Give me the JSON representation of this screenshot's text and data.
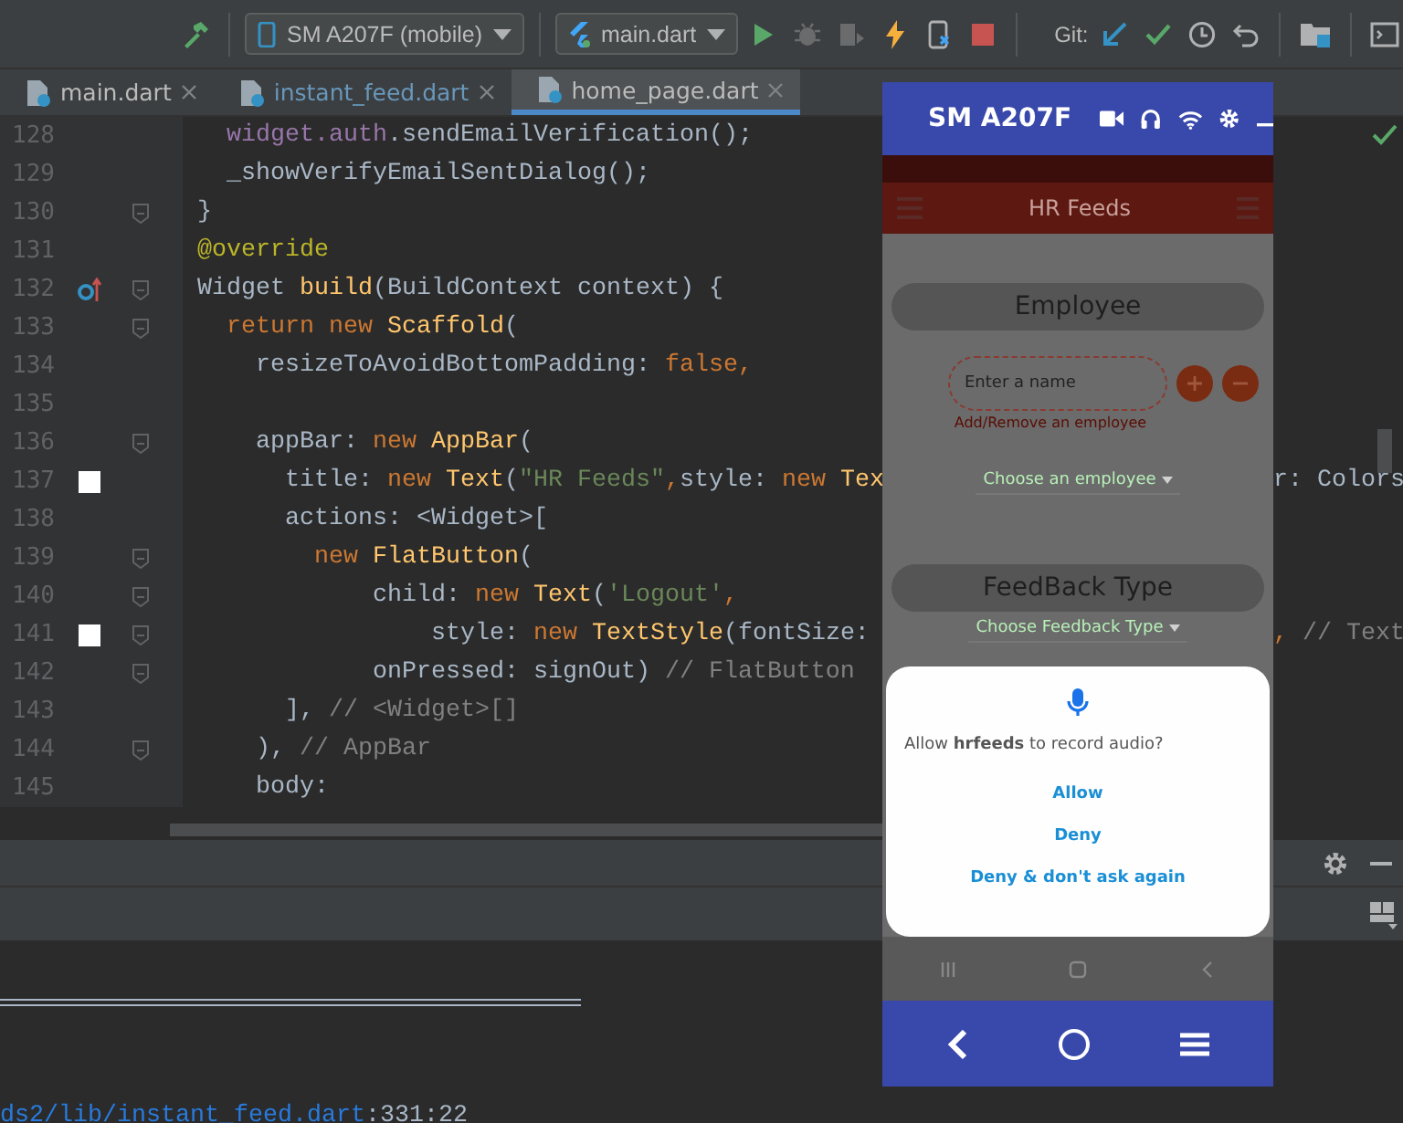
{
  "toolbar": {
    "device": "SM A207F (mobile)",
    "config": "main.dart",
    "git_label": "Git:",
    "actions": [
      {
        "kind": "run",
        "disabled": false
      },
      {
        "kind": "debug",
        "disabled": true
      },
      {
        "kind": "profile",
        "disabled": true
      },
      {
        "kind": "reload",
        "disabled": false
      },
      {
        "kind": "devtools",
        "disabled": false
      },
      {
        "kind": "stop",
        "disabled": false
      }
    ]
  },
  "tabs": [
    {
      "label": "main.dart",
      "selected": false,
      "modified": false
    },
    {
      "label": "instant_feed.dart",
      "selected": false,
      "modified": true
    },
    {
      "label": "home_page.dart",
      "selected": true,
      "modified": false
    }
  ],
  "editor": {
    "lines": [
      {
        "number": "128",
        "tokens": [
          {
            "t": "  widget.auth",
            "kind": "field"
          },
          {
            "t": ".sendEmailVerification();",
            "kind": "plain"
          }
        ]
      },
      {
        "number": "129",
        "tokens": [
          {
            "t": "  _showVerifyEmailSentDialog();",
            "kind": "plain"
          }
        ]
      },
      {
        "number": "130",
        "fold": true,
        "tokens": [
          {
            "t": "}",
            "kind": "plain"
          }
        ]
      },
      {
        "number": "131",
        "tokens": [
          {
            "t": "@override",
            "kind": "annotation"
          }
        ]
      },
      {
        "number": "132",
        "overridden": true,
        "fold": true,
        "tokens": [
          {
            "t": "Widget ",
            "kind": "plain"
          },
          {
            "t": "build",
            "kind": "class"
          },
          {
            "t": "(BuildContext context) {",
            "kind": "plain"
          }
        ]
      },
      {
        "number": "133",
        "fold": true,
        "tokens": [
          {
            "t": "  return new ",
            "kind": "keyword"
          },
          {
            "t": "Scaffold",
            "kind": "class"
          },
          {
            "t": "(",
            "kind": "plain"
          }
        ]
      },
      {
        "number": "134",
        "tokens": [
          {
            "t": "    resizeToAvoidBottomPadding: ",
            "kind": "plain"
          },
          {
            "t": "false,",
            "kind": "keyword"
          }
        ]
      },
      {
        "number": "135"
      },
      {
        "number": "136",
        "fold": true,
        "tokens": [
          {
            "t": "    appBar: ",
            "kind": "plain"
          },
          {
            "t": "new ",
            "kind": "keyword"
          },
          {
            "t": "AppBar",
            "kind": "class"
          },
          {
            "t": "(",
            "kind": "plain"
          }
        ]
      },
      {
        "number": "137",
        "swatch": true,
        "tokens": [
          {
            "t": "      title: ",
            "kind": "plain"
          },
          {
            "t": "new ",
            "kind": "keyword"
          },
          {
            "t": "Text",
            "kind": "class"
          },
          {
            "t": "(",
            "kind": "plain"
          },
          {
            "t": "\"HR Feeds\"",
            "kind": "string"
          },
          {
            "t": ",",
            "kind": "keyword"
          },
          {
            "t": "style: ",
            "kind": "plain"
          },
          {
            "t": "new ",
            "kind": "keyword"
          },
          {
            "t": "Tex",
            "kind": "class"
          }
        ],
        "tail": [
          {
            "t": "r: Colors",
            "kind": "plain"
          }
        ]
      },
      {
        "number": "138",
        "tokens": [
          {
            "t": "      actions: <Widget>[",
            "kind": "plain"
          }
        ]
      },
      {
        "number": "139",
        "fold": true,
        "tokens": [
          {
            "t": "        new ",
            "kind": "keyword"
          },
          {
            "t": "FlatButton",
            "kind": "class"
          },
          {
            "t": "(",
            "kind": "plain"
          }
        ]
      },
      {
        "number": "140",
        "fold": true,
        "tokens": [
          {
            "t": "            child: ",
            "kind": "plain"
          },
          {
            "t": "new ",
            "kind": "keyword"
          },
          {
            "t": "Text",
            "kind": "class"
          },
          {
            "t": "(",
            "kind": "plain"
          },
          {
            "t": "'Logout'",
            "kind": "string"
          },
          {
            "t": ",",
            "kind": "keyword"
          }
        ]
      },
      {
        "number": "141",
        "swatch": true,
        "fold": true,
        "tokens": [
          {
            "t": "                style: ",
            "kind": "plain"
          },
          {
            "t": "new ",
            "kind": "keyword"
          },
          {
            "t": "TextStyle",
            "kind": "class"
          },
          {
            "t": "(fontSize:",
            "kind": "plain"
          }
        ],
        "tail": [
          {
            "t": ",",
            "kind": "keyword"
          },
          {
            "t": " // Text",
            "kind": "comment"
          }
        ]
      },
      {
        "number": "142",
        "fold": true,
        "tokens": [
          {
            "t": "            onPressed: signOut) ",
            "kind": "plain"
          },
          {
            "t": "// FlatButton",
            "kind": "comment"
          }
        ]
      },
      {
        "number": "143",
        "tokens": [
          {
            "t": "      ], ",
            "kind": "plain"
          },
          {
            "t": "// <Widget>[]",
            "kind": "comment"
          }
        ]
      },
      {
        "number": "144",
        "fold": true,
        "tokens": [
          {
            "t": "    ), ",
            "kind": "plain"
          },
          {
            "t": "// AppBar",
            "kind": "comment"
          }
        ]
      },
      {
        "number": "145",
        "tokens": [
          {
            "t": "    body:",
            "kind": "plain"
          }
        ]
      }
    ]
  },
  "console": {
    "link": "ds2/lib/instant_feed.dart",
    "position": ":331:22"
  },
  "emulator": {
    "title": "SM A207F",
    "app": {
      "title": "HR Feeds",
      "employee_heading": "Employee",
      "name_placeholder": "Enter a name",
      "helper": "Add/Remove an employee",
      "employee_dropdown": "Choose an employee",
      "feedback_heading": "FeedBack Type",
      "feedback_dropdown": "Choose Feedback Type"
    },
    "dialog": {
      "message": "Allow **hrfeeds** to record audio?",
      "actions": [
        "Allow",
        "Deny",
        "Deny & don't ask again"
      ]
    }
  }
}
